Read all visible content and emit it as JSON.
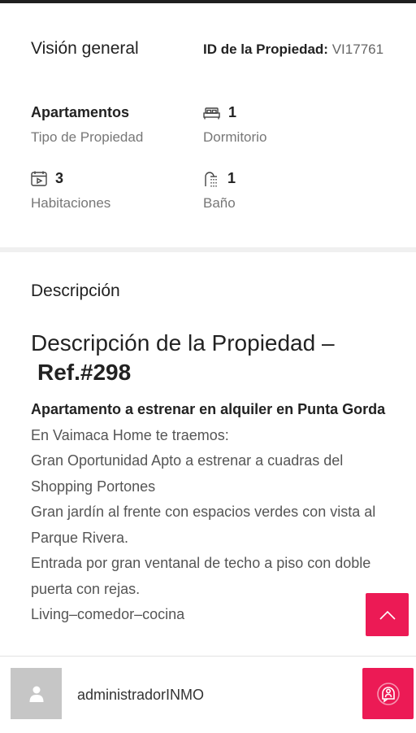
{
  "overview": {
    "title": "Visión general",
    "id_label": "ID de la Propiedad:",
    "id_value": "VI17761",
    "features": [
      {
        "icon": "property-type",
        "value": "Apartamentos",
        "label": "Tipo de Propiedad"
      },
      {
        "icon": "bed-icon",
        "value": "1",
        "label": "Dormitorio"
      },
      {
        "icon": "rooms-icon",
        "value": "3",
        "label": "Habitaciones"
      },
      {
        "icon": "shower-icon",
        "value": "1",
        "label": "Baño"
      }
    ]
  },
  "description": {
    "section_title": "Descripción",
    "heading": "Descripción de la Propiedad –",
    "ref": "Ref.#298",
    "paragraphs": [
      "Apartamento a estrenar en alquiler en Punta Gorda",
      "En Vaimaca Home te traemos:",
      "Gran Oportunidad Apto a estrenar a cuadras del Shopping Portones",
      "Gran jardín al frente con espacios verdes con vista al Parque Rivera.",
      "Entrada por gran ventanal de techo a piso con doble puerta con rejas.",
      "Living–comedor–cocina"
    ]
  },
  "footer": {
    "agent_name": "administradorINMO",
    "icons": {
      "avatar": "user-icon",
      "chat": "chat-icon",
      "scroll_top": "chevron-up-icon"
    }
  },
  "colors": {
    "accent": "#ec1a55",
    "background": "#f0f0f0"
  }
}
